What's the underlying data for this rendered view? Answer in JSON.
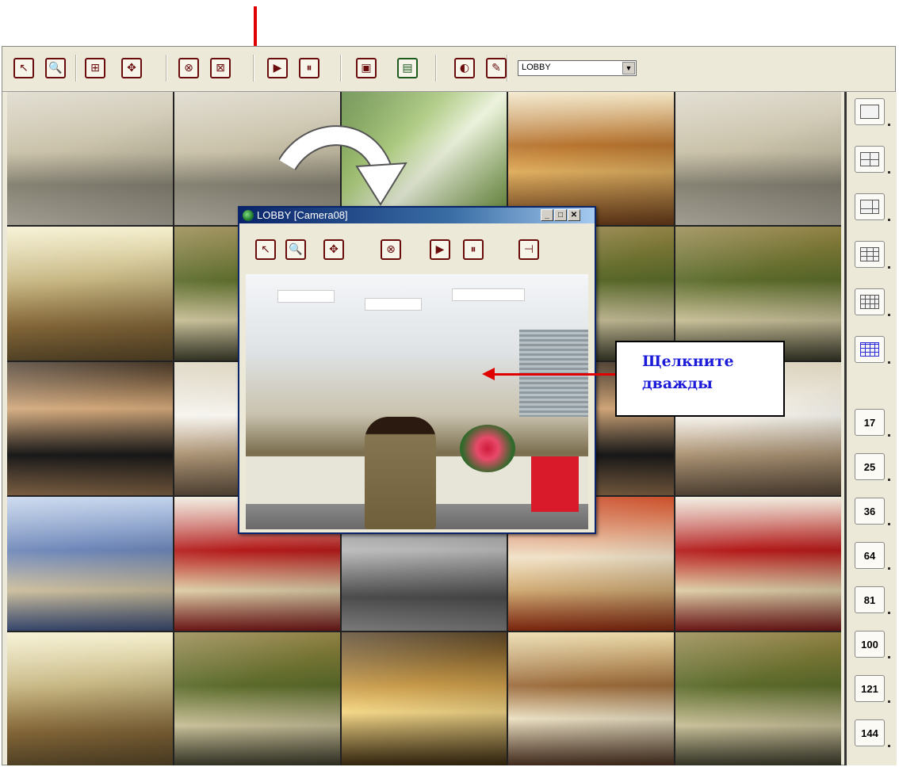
{
  "toolbar": {
    "buttons": [
      {
        "name": "select-arrow-icon",
        "glyph": "↖"
      },
      {
        "name": "zoom-icon",
        "glyph": "🔍"
      },
      {
        "name": "add-window-icon",
        "glyph": "⊞"
      },
      {
        "name": "pan-tilt-icon",
        "glyph": "✥"
      },
      {
        "name": "close-camera-icon",
        "glyph": "⊗"
      },
      {
        "name": "close-all-icon",
        "glyph": "⊠"
      },
      {
        "name": "play-icon",
        "glyph": "▶"
      },
      {
        "name": "pause-icon",
        "glyph": "⏸"
      },
      {
        "name": "layout-icon",
        "glyph": "▣"
      },
      {
        "name": "save-icon",
        "glyph": "▤"
      },
      {
        "name": "audio-icon",
        "glyph": "◐"
      },
      {
        "name": "microphone-icon",
        "glyph": "✎"
      }
    ],
    "camera_select": {
      "value": "LOBBY"
    }
  },
  "floating_window": {
    "title": "LOBBY [Camera08]",
    "controls": [
      "_",
      "□",
      "✕"
    ],
    "buttons": [
      {
        "name": "select-arrow-icon",
        "glyph": "↖"
      },
      {
        "name": "zoom-icon",
        "glyph": "🔍"
      },
      {
        "name": "pan-tilt-icon",
        "glyph": "✥"
      },
      {
        "name": "close-camera-icon",
        "glyph": "⊗"
      },
      {
        "name": "play-icon",
        "glyph": "▶"
      },
      {
        "name": "pause-icon",
        "glyph": "⏸"
      },
      {
        "name": "pin-icon",
        "glyph": "⊣"
      }
    ]
  },
  "callout": {
    "line1": "Щелкните",
    "line2": "дважды"
  },
  "layout_panel": {
    "icon_buttons": [
      "layout-1-icon",
      "layout-4-icon",
      "layout-6-icon",
      "layout-9-icon",
      "layout-12-icon",
      "layout-16-icon"
    ],
    "number_buttons": [
      "17",
      "25",
      "36",
      "64",
      "81",
      "100",
      "121",
      "144"
    ]
  },
  "grid": {
    "cells": [
      "bank",
      "bank",
      "veg",
      "food",
      "bank",
      "lobby",
      "rest",
      "rest",
      "rest",
      "rest",
      "party",
      "chef",
      "party",
      "party",
      "chef",
      "store",
      "coke",
      "park",
      "cake",
      "coke",
      "lobby",
      "rest",
      "hotel",
      "buffet",
      "rest"
    ]
  },
  "colors": {
    "accent_red": "#e00000",
    "callout_text": "#1b1bd9",
    "title_bar": "#0a246a"
  }
}
